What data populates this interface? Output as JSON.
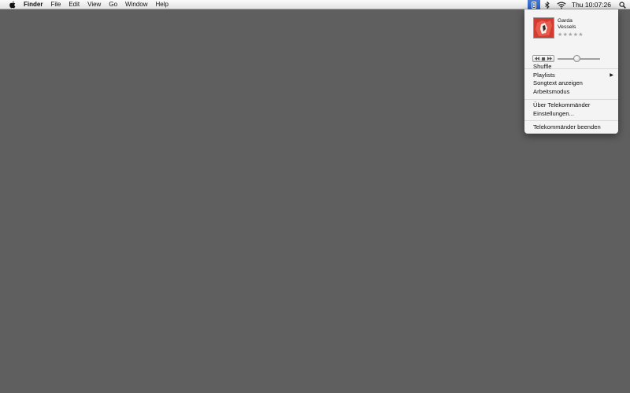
{
  "menubar": {
    "app_name": "Finder",
    "menus": [
      "File",
      "Edit",
      "View",
      "Go",
      "Window",
      "Help"
    ],
    "clock": "Thu 10:07:26"
  },
  "now_playing": {
    "title": "Garda",
    "artist": "Vessels",
    "rating": 0,
    "rating_display": "★★★★★",
    "volume_level": 0.45,
    "cover_color": "#d23b32"
  },
  "menu": {
    "shuffle": "Shuffle",
    "playlists": "Playlists",
    "lyrics": "Songtext anzeigen",
    "work_mode": "Arbeitsmodus",
    "about": "Über Telekommänder",
    "settings": "Einstellungen...",
    "quit": "Telekommänder beenden"
  },
  "colors": {
    "desktop": "#5f5f5f",
    "highlight": "#2a5bc1"
  },
  "icons": {
    "apple": "apple-logo-icon",
    "telekommander": "telekommander-icon",
    "bluetooth": "bluetooth-icon",
    "wifi": "wifi-icon",
    "spotlight": "spotlight-search-icon"
  }
}
